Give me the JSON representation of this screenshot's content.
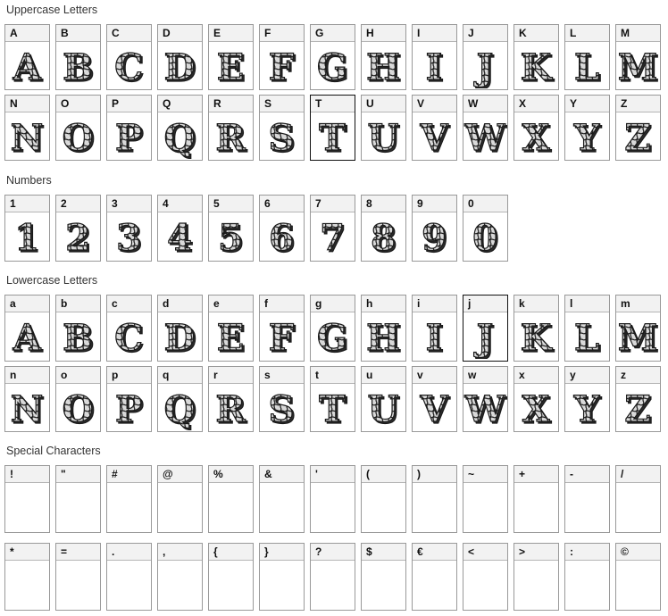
{
  "sections": [
    {
      "title": "Uppercase Letters"
    },
    {
      "title": "Numbers"
    },
    {
      "title": "Lowercase Letters"
    },
    {
      "title": "Special Characters"
    }
  ],
  "uppercase_row1": [
    "A",
    "B",
    "C",
    "D",
    "E",
    "F",
    "G",
    "H",
    "I",
    "J",
    "K",
    "L",
    "M"
  ],
  "uppercase_row2": [
    "N",
    "O",
    "P",
    "Q",
    "R",
    "S",
    "T",
    "U",
    "V",
    "W",
    "X",
    "Y",
    "Z"
  ],
  "numbers_row1": [
    "1",
    "2",
    "3",
    "4",
    "5",
    "6",
    "7",
    "8",
    "9",
    "0"
  ],
  "lowercase_row1": [
    "a",
    "b",
    "c",
    "d",
    "e",
    "f",
    "g",
    "h",
    "i",
    "j",
    "k",
    "l",
    "m"
  ],
  "lowercase_row2": [
    "n",
    "o",
    "p",
    "q",
    "r",
    "s",
    "t",
    "u",
    "v",
    "w",
    "x",
    "y",
    "z"
  ],
  "special_row1": [
    "!",
    "\"",
    "#",
    "@",
    "%",
    "&",
    "'",
    "(",
    ")",
    "~",
    "+",
    "-",
    "/"
  ],
  "special_row2": [
    "*",
    "=",
    ".",
    ",",
    "{",
    "}",
    "?",
    "$",
    "€",
    "<",
    ">",
    ":",
    "©"
  ],
  "colors": {
    "glyph_fill": "#d9d9d9",
    "glyph_shadow": "#2b2b2b",
    "glyph_stroke": "#1a1a1a"
  }
}
